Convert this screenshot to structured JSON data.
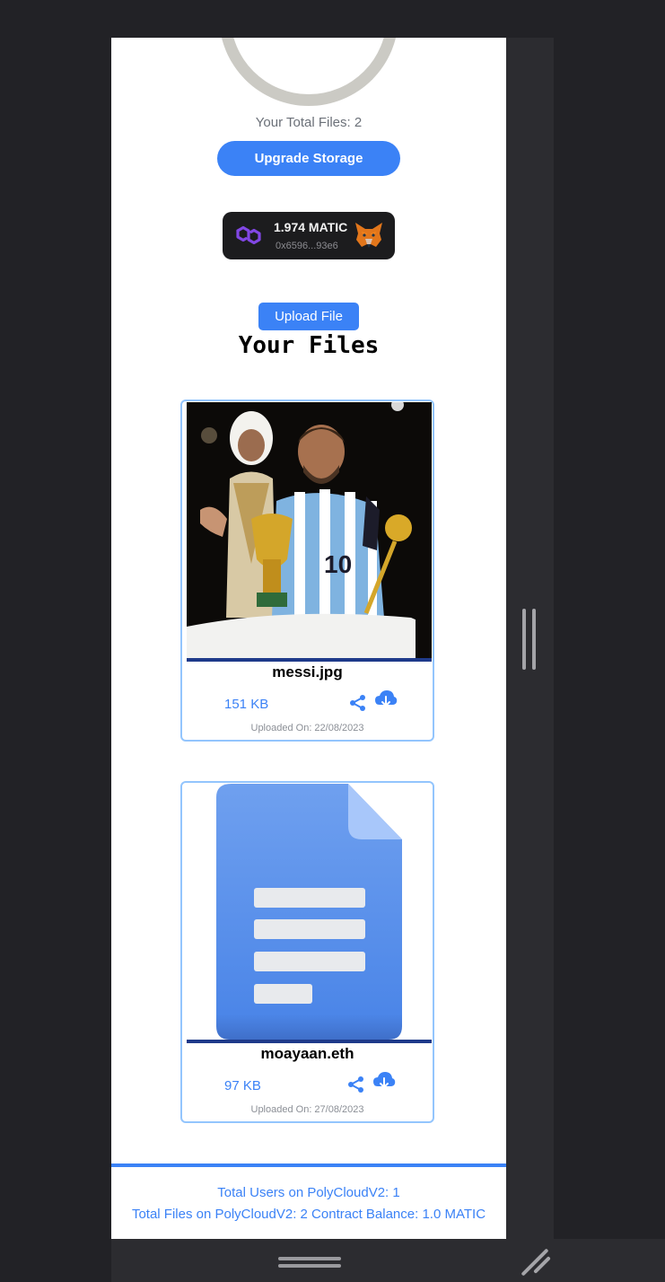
{
  "storage": {
    "total_files_text": "Your Total Files: 2",
    "upgrade_label": "Upgrade Storage"
  },
  "wallet": {
    "balance": "1.974 MATIC",
    "address": "0x6596...93e6",
    "network_icon": "polygon-icon",
    "wallet_icon": "metamask-fox-icon"
  },
  "upload_label": "Upload File",
  "files_title": "Your Files",
  "files": [
    {
      "name": "messi.jpg",
      "size": "151 KB",
      "uploaded": "Uploaded On: 22/08/2023",
      "thumbnail": "photo"
    },
    {
      "name": "moayaan.eth",
      "size": "97 KB",
      "uploaded": "Uploaded On: 27/08/2023",
      "thumbnail": "document-icon"
    }
  ],
  "footer": {
    "users": "Total Users on PolyCloudV2: 1",
    "stats": "Total Files on PolyCloudV2: 2 Contract Balance: 1.0 MATIC"
  },
  "colors": {
    "accent": "#3b82f6",
    "card_border": "#93c5fd",
    "thumb_underline": "#1e3a8a",
    "ring": "#cbcac4",
    "page_bg": "#222226"
  }
}
